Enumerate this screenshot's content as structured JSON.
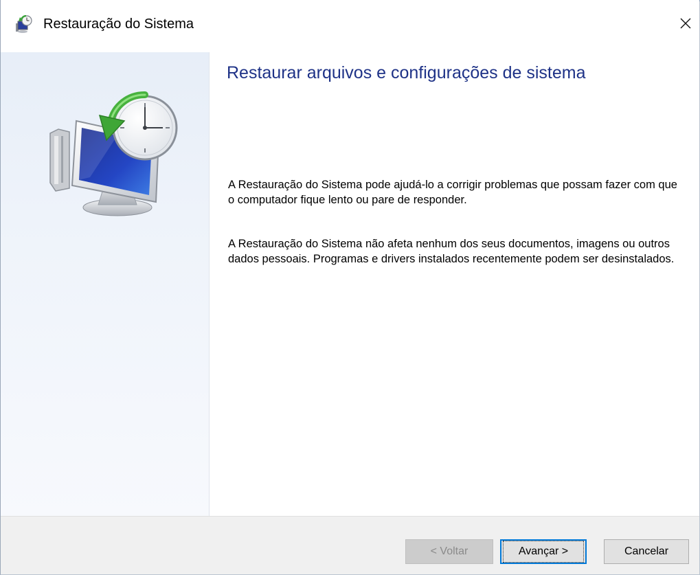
{
  "window": {
    "title": "Restauração do Sistema",
    "close_glyph": "✕",
    "title_icon": "system-restore-icon"
  },
  "sidebar": {
    "hero_icon": "system-restore-monitor-clock-icon"
  },
  "main": {
    "heading": "Restaurar arquivos e configurações de sistema",
    "paragraph1": "A Restauração do Sistema pode ajudá-lo a corrigir problemas que possam fazer com que o computador fique lento ou pare de responder.",
    "paragraph2": "A Restauração do Sistema não afeta nenhum dos seus documentos, imagens ou outros dados pessoais. Programas e drivers instalados recentemente podem ser desinstalados."
  },
  "footer": {
    "back_label": "< Voltar",
    "next_label": "Avançar >",
    "cancel_label": "Cancelar",
    "back_enabled": false
  },
  "colors": {
    "heading": "#1e3287",
    "accent": "#0078d7",
    "sidebar_bg": "#e7eef8",
    "footer_bg": "#f0f0f0"
  }
}
